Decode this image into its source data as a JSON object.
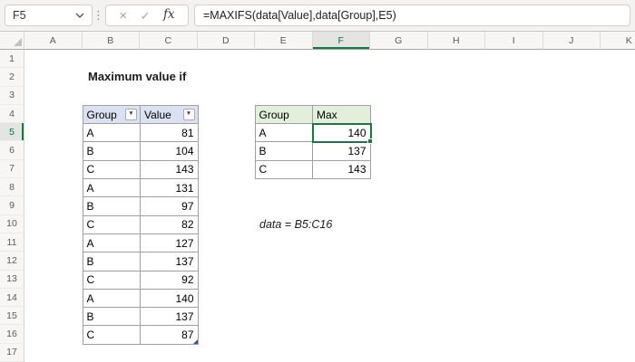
{
  "formula_bar": {
    "name_box": "F5",
    "dots_icon": "⋮",
    "cancel_icon": "×",
    "enter_icon": "✓",
    "fx_icon": "fx",
    "formula": "=MAXIFS(data[Value],data[Group],E5)"
  },
  "sheet": {
    "title": "Maximum value if",
    "note": "data = B5:C16",
    "columns": [
      {
        "label": "A"
      },
      {
        "label": "B"
      },
      {
        "label": "C"
      },
      {
        "label": "D"
      },
      {
        "label": "E"
      },
      {
        "label": "F",
        "selected": true
      },
      {
        "label": "G"
      },
      {
        "label": "H"
      },
      {
        "label": "I"
      },
      {
        "label": "J"
      },
      {
        "label": "K"
      }
    ],
    "rows": [
      {
        "label": "1"
      },
      {
        "label": "2"
      },
      {
        "label": "3"
      },
      {
        "label": "4"
      },
      {
        "label": "5",
        "selected": true
      },
      {
        "label": "6"
      },
      {
        "label": "7"
      },
      {
        "label": "8"
      },
      {
        "label": "9"
      },
      {
        "label": "10"
      },
      {
        "label": "11"
      },
      {
        "label": "12"
      },
      {
        "label": "13"
      },
      {
        "label": "14"
      },
      {
        "label": "15"
      },
      {
        "label": "16"
      },
      {
        "label": "17"
      }
    ],
    "data_table": {
      "range": "B4:C16",
      "filter_icon": "▼",
      "headers": [
        {
          "label": "Group"
        },
        {
          "label": "Value"
        }
      ],
      "rows": [
        {
          "group": "A",
          "value": "81"
        },
        {
          "group": "B",
          "value": "104"
        },
        {
          "group": "C",
          "value": "143"
        },
        {
          "group": "A",
          "value": "131"
        },
        {
          "group": "B",
          "value": "97"
        },
        {
          "group": "C",
          "value": "82"
        },
        {
          "group": "A",
          "value": "127"
        },
        {
          "group": "B",
          "value": "137"
        },
        {
          "group": "C",
          "value": "92"
        },
        {
          "group": "A",
          "value": "140"
        },
        {
          "group": "B",
          "value": "137"
        },
        {
          "group": "C",
          "value": "87"
        }
      ]
    },
    "summary_table": {
      "range": "E4:F7",
      "headers": [
        {
          "label": "Group"
        },
        {
          "label": "Max"
        }
      ],
      "rows": [
        {
          "group": "A",
          "max": "140",
          "selected": true
        },
        {
          "group": "B",
          "max": "137"
        },
        {
          "group": "C",
          "max": "143"
        }
      ]
    }
  },
  "colors": {
    "accent_green": "#107C41",
    "selection_border": "#217346",
    "table_header_blue": "#D9E1F2",
    "table_header_green": "#E2EFDA",
    "table_border_gray": "#A0A0A0",
    "resize_handle_blue": "#2E5596"
  }
}
